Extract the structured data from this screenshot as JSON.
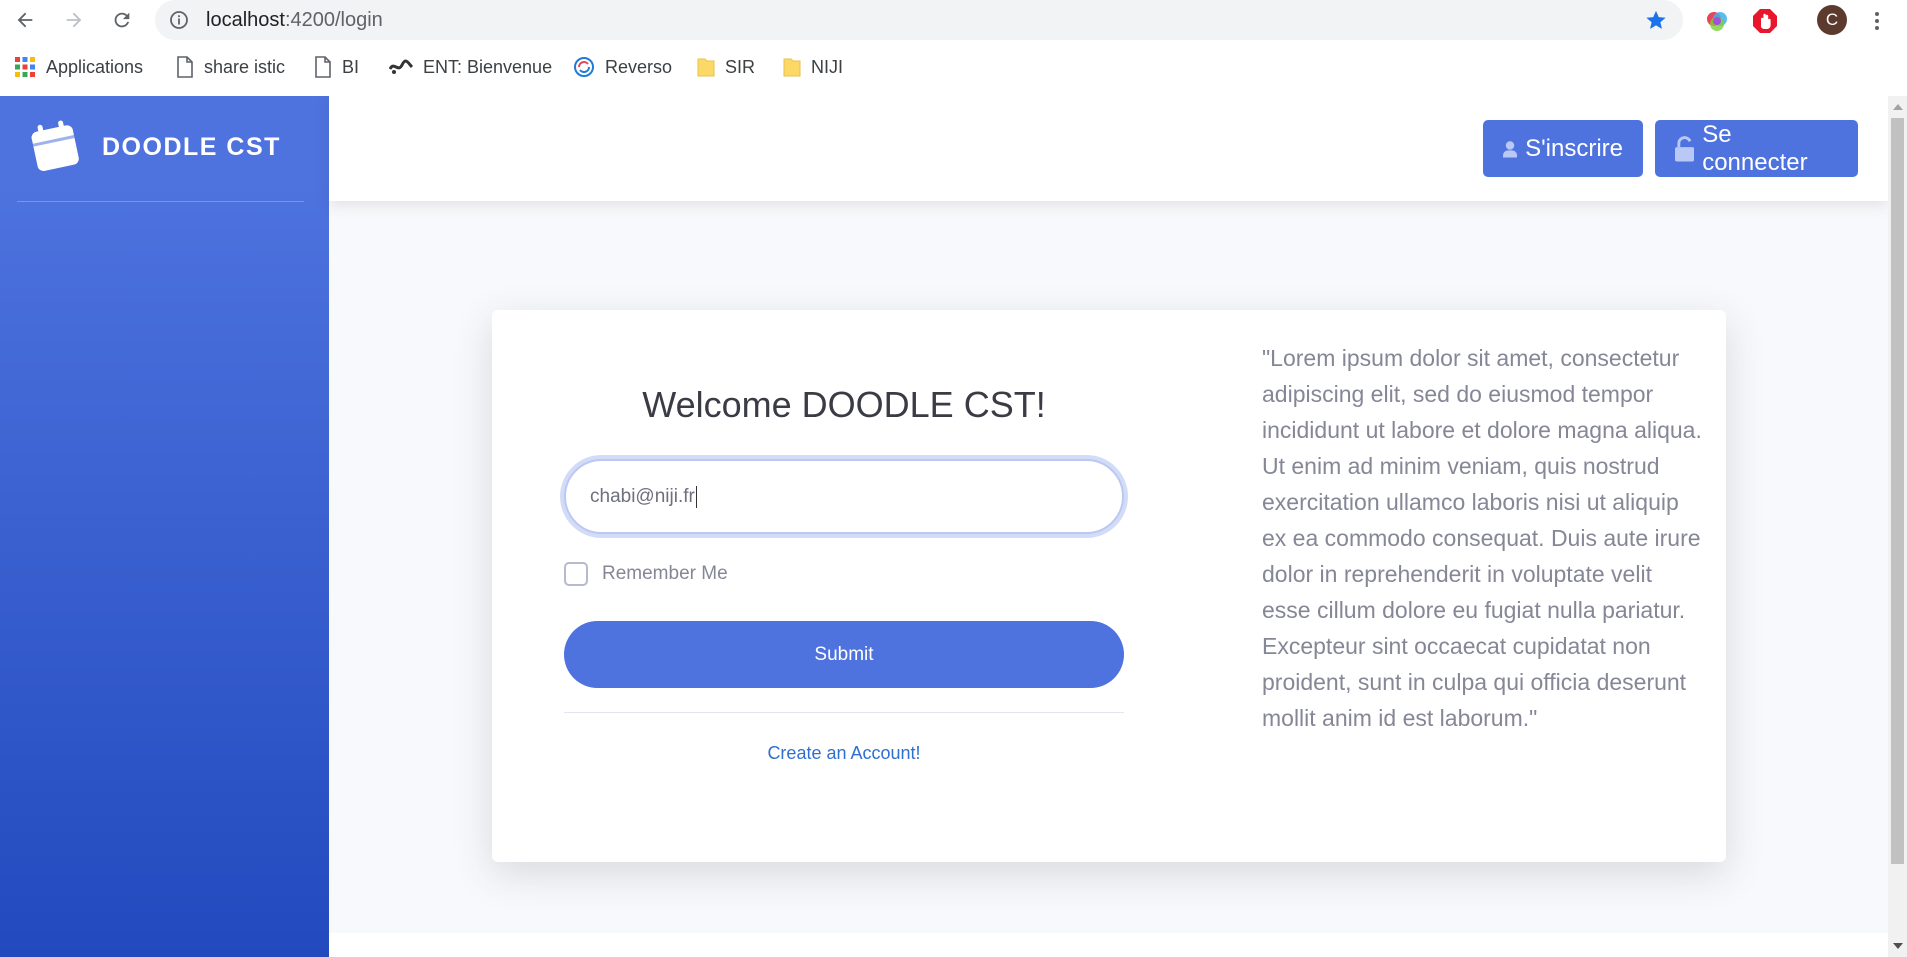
{
  "browser": {
    "url_host": "localhost",
    "url_path": ":4200/login",
    "profile_initial": "C"
  },
  "bookmarks": [
    {
      "label": "Applications",
      "icon": "apps-grid-icon"
    },
    {
      "label": "share istic",
      "icon": "page-icon"
    },
    {
      "label": "BI",
      "icon": "page-icon"
    },
    {
      "label": "ENT: Bienvenue",
      "icon": "ent-icon"
    },
    {
      "label": "Reverso",
      "icon": "reverso-icon"
    },
    {
      "label": "SIR",
      "icon": "folder-icon"
    },
    {
      "label": "NIJI",
      "icon": "folder-icon"
    }
  ],
  "app": {
    "brand": "DOODLE CST",
    "register_label": "S'inscrire",
    "login_label": "Se connecter"
  },
  "login": {
    "title": "Welcome DOODLE CST!",
    "email_value": "chabi@niji.fr",
    "remember_label": "Remember Me",
    "submit_label": "Submit",
    "create_account_label": "Create an Account!",
    "quote": "\"Lorem ipsum dolor sit amet, consectetur adipiscing elit, sed do eiusmod tempor incididunt ut labore et dolore magna aliqua. Ut enim ad minim veniam, quis nostrud exercitation ullamco laboris nisi ut aliquip ex ea commodo consequat. Duis aute irure dolor in reprehenderit in voluptate velit esse cillum dolore eu fugiat nulla pariatur. Excepteur sint occaecat cupidatat non proident, sunt in culpa qui officia deserunt mollit anim id est laborum.\""
  },
  "colors": {
    "primary": "#4e73df",
    "sidebar_bottom": "#224abe",
    "link": "#2f6fd0"
  }
}
